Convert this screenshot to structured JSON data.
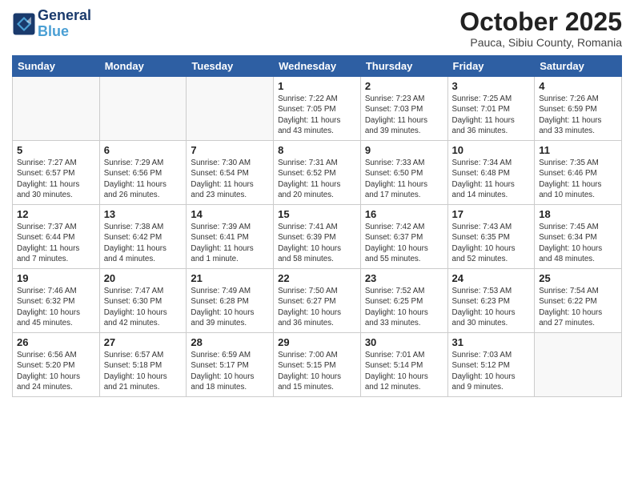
{
  "logo": {
    "line1": "General",
    "line2": "Blue"
  },
  "title": "October 2025",
  "subtitle": "Pauca, Sibiu County, Romania",
  "days_header": [
    "Sunday",
    "Monday",
    "Tuesday",
    "Wednesday",
    "Thursday",
    "Friday",
    "Saturday"
  ],
  "weeks": [
    [
      {
        "day": "",
        "info": ""
      },
      {
        "day": "",
        "info": ""
      },
      {
        "day": "",
        "info": ""
      },
      {
        "day": "1",
        "info": "Sunrise: 7:22 AM\nSunset: 7:05 PM\nDaylight: 11 hours\nand 43 minutes."
      },
      {
        "day": "2",
        "info": "Sunrise: 7:23 AM\nSunset: 7:03 PM\nDaylight: 11 hours\nand 39 minutes."
      },
      {
        "day": "3",
        "info": "Sunrise: 7:25 AM\nSunset: 7:01 PM\nDaylight: 11 hours\nand 36 minutes."
      },
      {
        "day": "4",
        "info": "Sunrise: 7:26 AM\nSunset: 6:59 PM\nDaylight: 11 hours\nand 33 minutes."
      }
    ],
    [
      {
        "day": "5",
        "info": "Sunrise: 7:27 AM\nSunset: 6:57 PM\nDaylight: 11 hours\nand 30 minutes."
      },
      {
        "day": "6",
        "info": "Sunrise: 7:29 AM\nSunset: 6:56 PM\nDaylight: 11 hours\nand 26 minutes."
      },
      {
        "day": "7",
        "info": "Sunrise: 7:30 AM\nSunset: 6:54 PM\nDaylight: 11 hours\nand 23 minutes."
      },
      {
        "day": "8",
        "info": "Sunrise: 7:31 AM\nSunset: 6:52 PM\nDaylight: 11 hours\nand 20 minutes."
      },
      {
        "day": "9",
        "info": "Sunrise: 7:33 AM\nSunset: 6:50 PM\nDaylight: 11 hours\nand 17 minutes."
      },
      {
        "day": "10",
        "info": "Sunrise: 7:34 AM\nSunset: 6:48 PM\nDaylight: 11 hours\nand 14 minutes."
      },
      {
        "day": "11",
        "info": "Sunrise: 7:35 AM\nSunset: 6:46 PM\nDaylight: 11 hours\nand 10 minutes."
      }
    ],
    [
      {
        "day": "12",
        "info": "Sunrise: 7:37 AM\nSunset: 6:44 PM\nDaylight: 11 hours\nand 7 minutes."
      },
      {
        "day": "13",
        "info": "Sunrise: 7:38 AM\nSunset: 6:42 PM\nDaylight: 11 hours\nand 4 minutes."
      },
      {
        "day": "14",
        "info": "Sunrise: 7:39 AM\nSunset: 6:41 PM\nDaylight: 11 hours\nand 1 minute."
      },
      {
        "day": "15",
        "info": "Sunrise: 7:41 AM\nSunset: 6:39 PM\nDaylight: 10 hours\nand 58 minutes."
      },
      {
        "day": "16",
        "info": "Sunrise: 7:42 AM\nSunset: 6:37 PM\nDaylight: 10 hours\nand 55 minutes."
      },
      {
        "day": "17",
        "info": "Sunrise: 7:43 AM\nSunset: 6:35 PM\nDaylight: 10 hours\nand 52 minutes."
      },
      {
        "day": "18",
        "info": "Sunrise: 7:45 AM\nSunset: 6:34 PM\nDaylight: 10 hours\nand 48 minutes."
      }
    ],
    [
      {
        "day": "19",
        "info": "Sunrise: 7:46 AM\nSunset: 6:32 PM\nDaylight: 10 hours\nand 45 minutes."
      },
      {
        "day": "20",
        "info": "Sunrise: 7:47 AM\nSunset: 6:30 PM\nDaylight: 10 hours\nand 42 minutes."
      },
      {
        "day": "21",
        "info": "Sunrise: 7:49 AM\nSunset: 6:28 PM\nDaylight: 10 hours\nand 39 minutes."
      },
      {
        "day": "22",
        "info": "Sunrise: 7:50 AM\nSunset: 6:27 PM\nDaylight: 10 hours\nand 36 minutes."
      },
      {
        "day": "23",
        "info": "Sunrise: 7:52 AM\nSunset: 6:25 PM\nDaylight: 10 hours\nand 33 minutes."
      },
      {
        "day": "24",
        "info": "Sunrise: 7:53 AM\nSunset: 6:23 PM\nDaylight: 10 hours\nand 30 minutes."
      },
      {
        "day": "25",
        "info": "Sunrise: 7:54 AM\nSunset: 6:22 PM\nDaylight: 10 hours\nand 27 minutes."
      }
    ],
    [
      {
        "day": "26",
        "info": "Sunrise: 6:56 AM\nSunset: 5:20 PM\nDaylight: 10 hours\nand 24 minutes."
      },
      {
        "day": "27",
        "info": "Sunrise: 6:57 AM\nSunset: 5:18 PM\nDaylight: 10 hours\nand 21 minutes."
      },
      {
        "day": "28",
        "info": "Sunrise: 6:59 AM\nSunset: 5:17 PM\nDaylight: 10 hours\nand 18 minutes."
      },
      {
        "day": "29",
        "info": "Sunrise: 7:00 AM\nSunset: 5:15 PM\nDaylight: 10 hours\nand 15 minutes."
      },
      {
        "day": "30",
        "info": "Sunrise: 7:01 AM\nSunset: 5:14 PM\nDaylight: 10 hours\nand 12 minutes."
      },
      {
        "day": "31",
        "info": "Sunrise: 7:03 AM\nSunset: 5:12 PM\nDaylight: 10 hours\nand 9 minutes."
      },
      {
        "day": "",
        "info": ""
      }
    ]
  ]
}
